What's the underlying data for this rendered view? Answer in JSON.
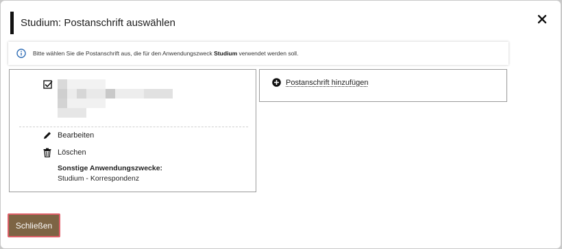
{
  "dialog": {
    "title": "Studium: Postanschrift auswählen",
    "close_icon": "close-icon",
    "info": {
      "icon": "info-circle-icon",
      "text_before": "Bitte wählen Sie die Postanschrift aus, die für den Anwendungszweck ",
      "text_bold": "Studium",
      "text_after": " verwendet werden soll."
    },
    "address_card": {
      "checkbox_icon": "checked-checkbox-icon",
      "edit_label": "Bearbeiten",
      "delete_label": "Löschen",
      "other_purposes_title": "Sonstige Anwendungszwecke:",
      "other_purposes_value": "Studium - Korrespondenz"
    },
    "add_card": {
      "icon": "plus-circle-icon",
      "label": "Postanschrift hinzufügen"
    },
    "footer": {
      "close_button_label": "Schließen"
    }
  },
  "colors": {
    "primary_button": "#7d6444",
    "focus_outline": "#e0606a",
    "info_icon": "#2f6db5"
  }
}
